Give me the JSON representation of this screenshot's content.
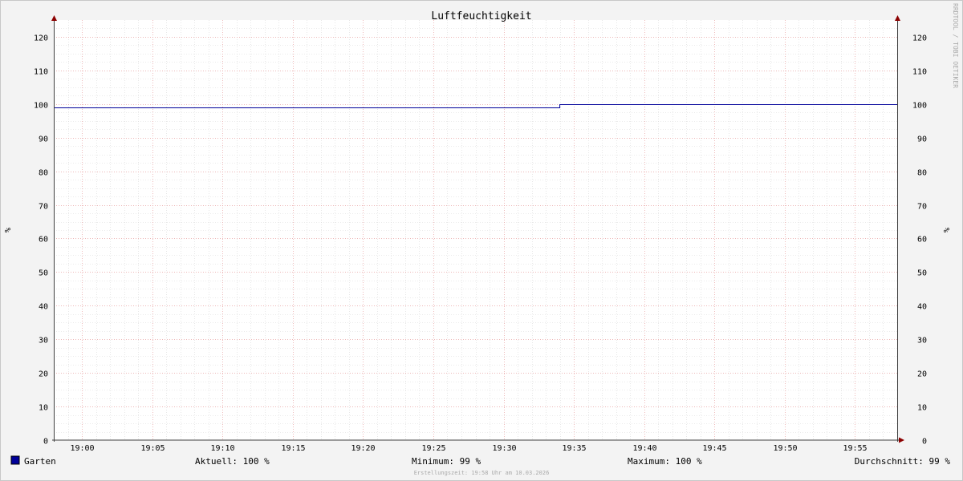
{
  "chart_data": {
    "type": "line",
    "title": "Luftfeuchtigkeit",
    "ylabel": "%",
    "ylim": [
      0,
      125
    ],
    "y_ticks": [
      0,
      10,
      20,
      30,
      40,
      50,
      60,
      70,
      80,
      90,
      100,
      110,
      120
    ],
    "x_tick_labels": [
      "19:00",
      "19:05",
      "19:10",
      "19:15",
      "19:20",
      "19:25",
      "19:30",
      "19:35",
      "19:40",
      "19:45",
      "19:50",
      "19:55"
    ],
    "x_range_minutes": [
      "18:58",
      "19:58"
    ],
    "grid": true,
    "series": [
      {
        "name": "Garten",
        "color": "#000099",
        "points": [
          {
            "t": "18:58",
            "y": 99
          },
          {
            "t": "19:34",
            "y": 99
          },
          {
            "t": "19:34",
            "y": 100
          },
          {
            "t": "19:58",
            "y": 100
          }
        ]
      }
    ],
    "legend": {
      "placement": "bottom",
      "series_label": "Garten",
      "stats": [
        {
          "label": "Aktuell:",
          "value": "100 %"
        },
        {
          "label": "Minimum:",
          "value": "99 %"
        },
        {
          "label": "Maximum:",
          "value": "100 %"
        },
        {
          "label": "Durchschnitt:",
          "value": "99 %"
        }
      ]
    },
    "footer": "Erstellungszeit: 19:58 Uhr am 10.03.2026",
    "watermark": "RRDTOOL / TOBI OETIKER"
  }
}
